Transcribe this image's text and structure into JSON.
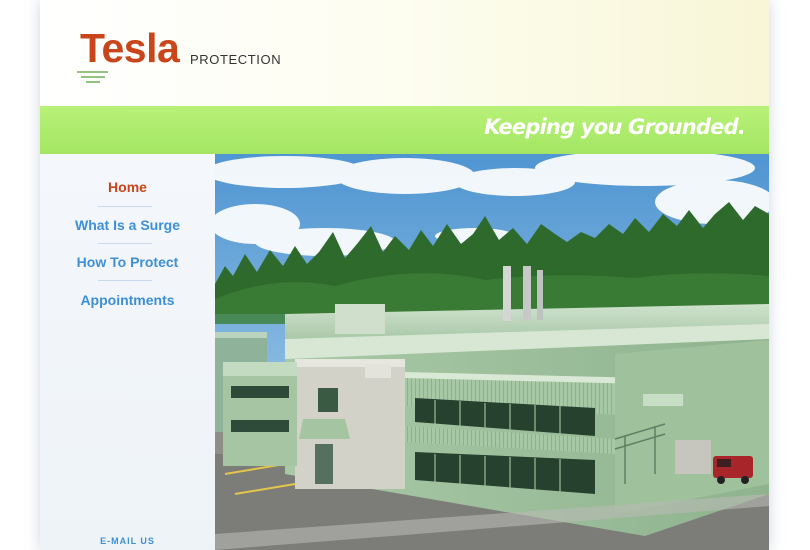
{
  "brand": {
    "name": "Tesla",
    "sub": "PROTECTION",
    "color": "#c8461a"
  },
  "banner": {
    "tagline": "Keeping you Grounded.",
    "color": "#a8e86a"
  },
  "nav": {
    "items": [
      {
        "label": "Home",
        "active": true
      },
      {
        "label": "What Is a Surge",
        "active": false
      },
      {
        "label": "How To Protect",
        "active": false
      },
      {
        "label": "Appointments",
        "active": false
      }
    ],
    "email_label": "E-MAIL US",
    "link_color": "#3d8fd6"
  },
  "hero": {
    "icon": "industrial-building-photo"
  }
}
